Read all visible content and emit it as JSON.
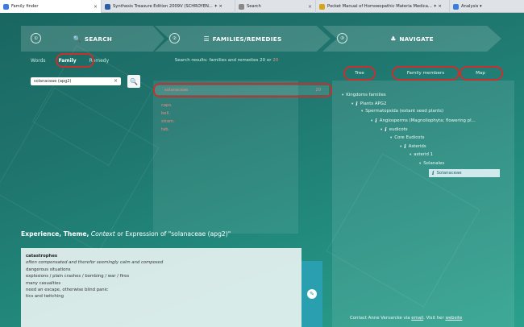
{
  "tabs": [
    {
      "label": "Family finder",
      "icon": "app-icon",
      "color": "#3b7ddd",
      "close": "×",
      "active": true
    },
    {
      "label": "Synthesis Treasure Edition 2009V (SCHROYEN... ✦ ×",
      "icon": "book-icon",
      "color": "#2a5fa8",
      "close": "",
      "active": false
    },
    {
      "label": "Search",
      "icon": "search-icon",
      "color": "#888888",
      "close": "×",
      "active": false
    },
    {
      "label": "Pocket Manual of Homoeopathic Materia Medica... ✦ ×",
      "icon": "book-icon",
      "color": "#d9a21b",
      "close": "",
      "active": false
    },
    {
      "label": "Analysis ▾",
      "icon": "chart-icon",
      "color": "#3b7ddd",
      "close": "",
      "active": false
    }
  ],
  "steps": [
    {
      "num": "①",
      "icon": "🔍",
      "title": "SEARCH"
    },
    {
      "num": "②",
      "icon": "☰",
      "title": "FAMILIES/REMEDIES"
    },
    {
      "num": "③",
      "icon": "♣",
      "title": "NAVIGATE"
    }
  ],
  "search": {
    "modes": [
      "Words",
      "Family",
      "Remedy"
    ],
    "active_mode": "Family",
    "query": "solanaceae (apg2)",
    "clear": "×",
    "button_icon": "🔍"
  },
  "results": {
    "heading": "Search results: families and remedies 20 or",
    "count": "20",
    "first_name": "solanaceae",
    "first_count": "20",
    "items": [
      "caps.",
      "bell.",
      "stram.",
      "tab."
    ]
  },
  "navigate": {
    "tabs": [
      "Tree",
      "Family members",
      "Map"
    ],
    "tree": [
      {
        "label": "Kingdoms families",
        "depth": 0,
        "arrow": "▾",
        "info": false,
        "selected": false
      },
      {
        "label": "Plants APG2",
        "depth": 1,
        "arrow": "▾",
        "info": true,
        "selected": false
      },
      {
        "label": "Spermatopsida (extant seed plants)",
        "depth": 2,
        "arrow": "▾",
        "info": false,
        "selected": false
      },
      {
        "label": "Angiosperms (Magnoliophyta; flowering pl...",
        "depth": 3,
        "arrow": "▾",
        "info": true,
        "selected": false
      },
      {
        "label": "eudicots",
        "depth": 4,
        "arrow": "▾",
        "info": true,
        "selected": false
      },
      {
        "label": "Core Eudicots",
        "depth": 5,
        "arrow": "▾",
        "info": false,
        "selected": false
      },
      {
        "label": "Asterids",
        "depth": 6,
        "arrow": "▾",
        "info": true,
        "selected": false
      },
      {
        "label": "asterid 1",
        "depth": 7,
        "arrow": "▾",
        "info": false,
        "selected": false
      },
      {
        "label": "Solanales",
        "depth": 8,
        "arrow": "▾",
        "info": false,
        "selected": false
      },
      {
        "label": "Solanaceae",
        "depth": 9,
        "arrow": "",
        "info": true,
        "selected": true
      }
    ],
    "contact_prefix": "Contact Anne Vervarcke via ",
    "contact_email": "email",
    "contact_mid": ". Visit her ",
    "contact_site": "website"
  },
  "experience": {
    "title_bold": "Experience, Theme,",
    "title_italic": "Context",
    "title_rest": "or Expression of \"solanaceae (apg2)\"",
    "lines": [
      {
        "text": "catastrophes",
        "style": "h"
      },
      {
        "text": "often compensated and therefor seemingly calm and composed",
        "style": "it"
      },
      {
        "text": "dangerous situations",
        "style": ""
      },
      {
        "text": "explosions / plain crashes / bombing / war / fires",
        "style": ""
      },
      {
        "text": "many casualties",
        "style": ""
      },
      {
        "text": "need an escape, otherwise blind panic",
        "style": ""
      },
      {
        "text": "tics and twitching",
        "style": ""
      }
    ],
    "edit_icon": "✎"
  },
  "colors": {
    "annotation": "#c8302e",
    "accent": "#2a9fb0",
    "result_text": "#f08a84"
  }
}
